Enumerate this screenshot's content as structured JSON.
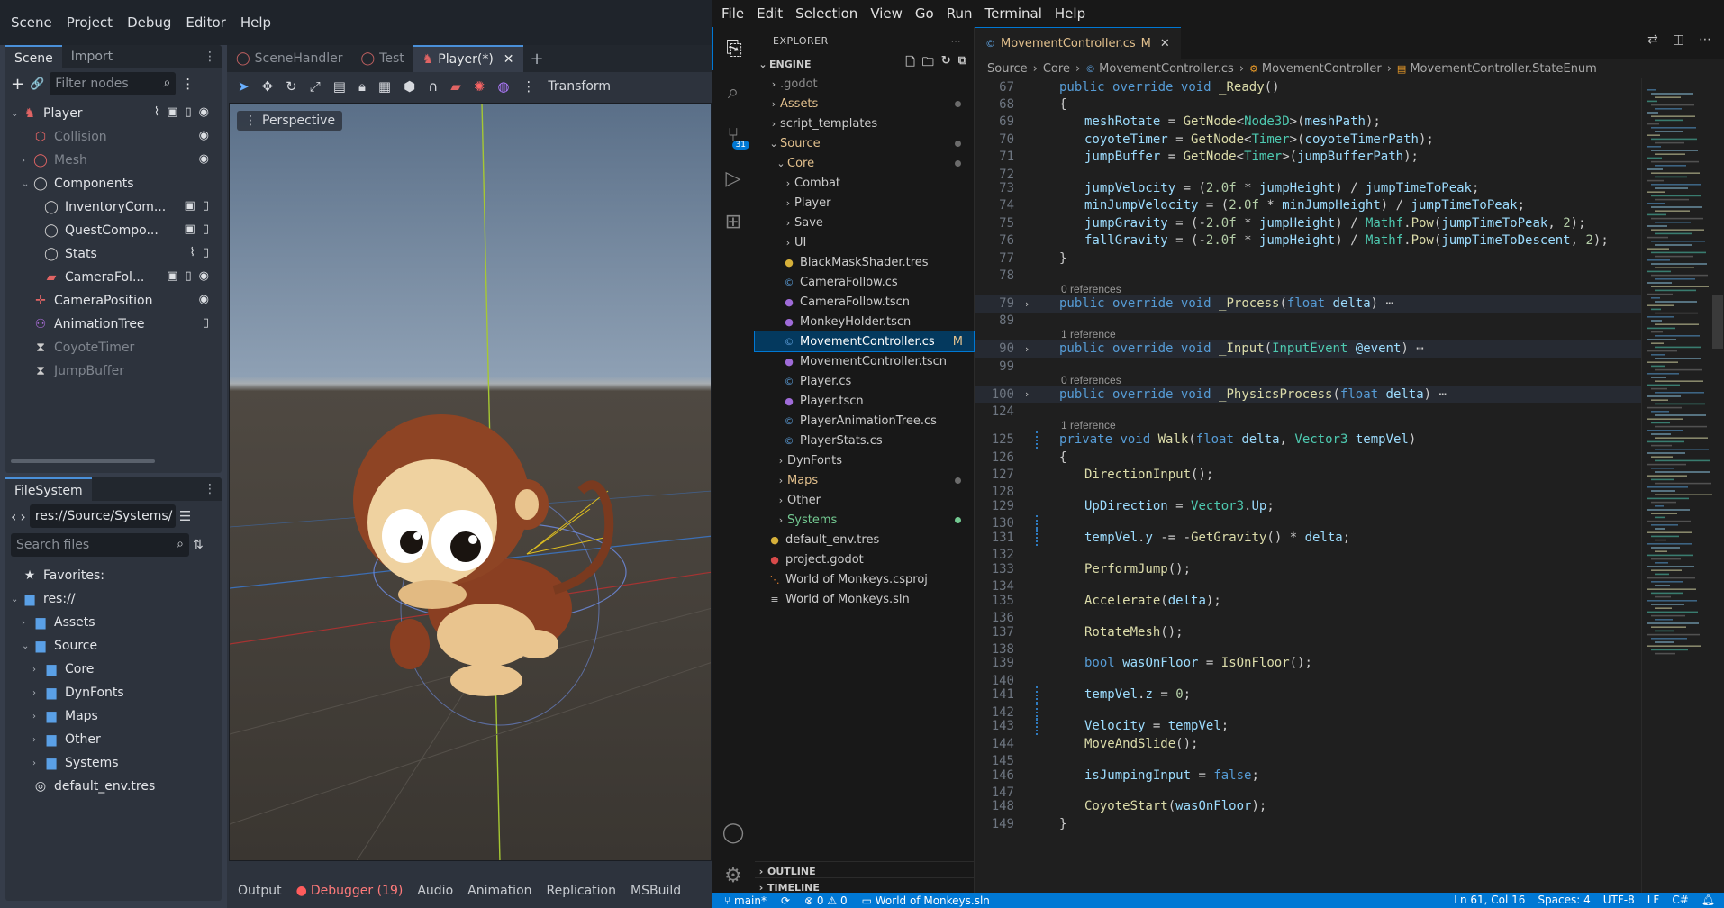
{
  "godot": {
    "menu": [
      "Scene",
      "Project",
      "Debug",
      "Editor",
      "Help"
    ],
    "scene_dock": {
      "tabs": [
        "Scene",
        "Import"
      ],
      "filter_placeholder": "Filter nodes",
      "nodes": [
        {
          "label": "Player",
          "depth": 0,
          "arrow": "v",
          "icon": "player-node-icon",
          "color": "#e06464"
        },
        {
          "label": "Collision",
          "depth": 1,
          "arrow": "",
          "icon": "collision-shape-icon",
          "color": "#e06464",
          "dim": true
        },
        {
          "label": "Mesh",
          "depth": 1,
          "arrow": ">",
          "icon": "mesh-node-icon",
          "color": "#e06464",
          "dim": true
        },
        {
          "label": "Components",
          "depth": 1,
          "arrow": "v",
          "icon": "node-icon",
          "color": "#cccccc"
        },
        {
          "label": "InventoryCom...",
          "depth": 2,
          "arrow": "",
          "icon": "node-icon",
          "color": "#cccccc"
        },
        {
          "label": "QuestCompo...",
          "depth": 2,
          "arrow": "",
          "icon": "node-icon",
          "color": "#cccccc"
        },
        {
          "label": "Stats",
          "depth": 2,
          "arrow": "",
          "icon": "node-icon",
          "color": "#cccccc"
        },
        {
          "label": "CameraFol...",
          "depth": 2,
          "arrow": "",
          "icon": "camera-node-icon",
          "color": "#e06464"
        },
        {
          "label": "CameraPosition",
          "depth": 1,
          "arrow": "",
          "icon": "marker-node-icon",
          "color": "#e06464"
        },
        {
          "label": "AnimationTree",
          "depth": 1,
          "arrow": "",
          "icon": "animation-tree-icon",
          "color": "#b070e0"
        },
        {
          "label": "CoyoteTimer",
          "depth": 1,
          "arrow": "",
          "icon": "timer-icon",
          "color": "#cccccc",
          "dim": true
        },
        {
          "label": "JumpBuffer",
          "depth": 1,
          "arrow": "",
          "icon": "timer-icon",
          "color": "#cccccc",
          "dim": true
        }
      ]
    },
    "filesystem": {
      "title": "FileSystem",
      "path": "res://Source/Systems/",
      "search_placeholder": "Search files",
      "items": [
        {
          "label": "Favorites:",
          "depth": 0,
          "arrow": "",
          "icon": "star-icon"
        },
        {
          "label": "res://",
          "depth": 0,
          "arrow": "v",
          "icon": "folder-icon"
        },
        {
          "label": "Assets",
          "depth": 1,
          "arrow": ">",
          "icon": "folder-icon"
        },
        {
          "label": "Source",
          "depth": 1,
          "arrow": "v",
          "icon": "folder-icon"
        },
        {
          "label": "Core",
          "depth": 2,
          "arrow": ">",
          "icon": "folder-icon"
        },
        {
          "label": "DynFonts",
          "depth": 2,
          "arrow": ">",
          "icon": "folder-icon"
        },
        {
          "label": "Maps",
          "depth": 2,
          "arrow": ">",
          "icon": "folder-icon"
        },
        {
          "label": "Other",
          "depth": 2,
          "arrow": ">",
          "icon": "folder-icon"
        },
        {
          "label": "Systems",
          "depth": 2,
          "arrow": ">",
          "icon": "folder-icon"
        },
        {
          "label": "default_env.tres",
          "depth": 1,
          "arrow": "",
          "icon": "globe-icon"
        }
      ]
    },
    "scene_tabs": [
      {
        "label": "SceneHandler",
        "active": false
      },
      {
        "label": "Test",
        "active": false
      },
      {
        "label": "Player(*)",
        "active": true
      }
    ],
    "toolbar_text": "Transform",
    "perspective_label": "Perspective",
    "bottom_tabs": [
      "Output",
      "Debugger (19)",
      "Audio",
      "Animation",
      "Replication",
      "MSBuild"
    ]
  },
  "vscode": {
    "menu": [
      "File",
      "Edit",
      "Selection",
      "View",
      "Go",
      "Run",
      "Terminal",
      "Help"
    ],
    "explorer": {
      "title": "EXPLORER",
      "section": "ENGINE",
      "items": [
        {
          "label": ".godot",
          "depth": 0,
          "chev": ">",
          "icon": "",
          "color": "#8b8b8b",
          "dot": ""
        },
        {
          "label": "Assets",
          "depth": 0,
          "chev": ">",
          "icon": "",
          "color": "#e2c08d",
          "dot": "#6b6b6b"
        },
        {
          "label": "script_templates",
          "depth": 0,
          "chev": ">",
          "icon": "",
          "color": "#cccccc",
          "dot": ""
        },
        {
          "label": "Source",
          "depth": 0,
          "chev": "v",
          "icon": "",
          "color": "#e2c08d",
          "dot": "#6b6b6b"
        },
        {
          "label": "Core",
          "depth": 1,
          "chev": "v",
          "icon": "",
          "color": "#e2c08d",
          "dot": "#6b6b6b"
        },
        {
          "label": "Combat",
          "depth": 2,
          "chev": ">",
          "icon": "",
          "color": "#cccccc",
          "dot": ""
        },
        {
          "label": "Player",
          "depth": 2,
          "chev": ">",
          "icon": "",
          "color": "#cccccc",
          "dot": ""
        },
        {
          "label": "Save",
          "depth": 2,
          "chev": ">",
          "icon": "",
          "color": "#cccccc",
          "dot": ""
        },
        {
          "label": "UI",
          "depth": 2,
          "chev": ">",
          "icon": "",
          "color": "#cccccc",
          "dot": ""
        },
        {
          "label": "BlackMaskShader.tres",
          "depth": 2,
          "chev": "",
          "icon": "tres-file-icon",
          "color": "#cccccc",
          "dot": ""
        },
        {
          "label": "CameraFollow.cs",
          "depth": 2,
          "chev": "",
          "icon": "csharp-file-icon",
          "color": "#cccccc",
          "dot": ""
        },
        {
          "label": "CameraFollow.tscn",
          "depth": 2,
          "chev": "",
          "icon": "tscn-file-icon",
          "color": "#cccccc",
          "dot": ""
        },
        {
          "label": "MonkeyHolder.tscn",
          "depth": 2,
          "chev": "",
          "icon": "tscn-file-icon",
          "color": "#cccccc",
          "dot": ""
        },
        {
          "label": "MovementController.cs",
          "depth": 2,
          "chev": "",
          "icon": "csharp-file-icon",
          "color": "#ffffff",
          "dot": "",
          "selected": true,
          "badge": "M"
        },
        {
          "label": "MovementController.tscn",
          "depth": 2,
          "chev": "",
          "icon": "tscn-file-icon",
          "color": "#cccccc",
          "dot": ""
        },
        {
          "label": "Player.cs",
          "depth": 2,
          "chev": "",
          "icon": "csharp-file-icon",
          "color": "#cccccc",
          "dot": ""
        },
        {
          "label": "Player.tscn",
          "depth": 2,
          "chev": "",
          "icon": "tscn-file-icon",
          "color": "#cccccc",
          "dot": ""
        },
        {
          "label": "PlayerAnimationTree.cs",
          "depth": 2,
          "chev": "",
          "icon": "csharp-file-icon",
          "color": "#cccccc",
          "dot": ""
        },
        {
          "label": "PlayerStats.cs",
          "depth": 2,
          "chev": "",
          "icon": "csharp-file-icon",
          "color": "#cccccc",
          "dot": ""
        },
        {
          "label": "DynFonts",
          "depth": 1,
          "chev": ">",
          "icon": "",
          "color": "#cccccc",
          "dot": ""
        },
        {
          "label": "Maps",
          "depth": 1,
          "chev": ">",
          "icon": "",
          "color": "#e2c08d",
          "dot": "#6b6b6b"
        },
        {
          "label": "Other",
          "depth": 1,
          "chev": ">",
          "icon": "",
          "color": "#cccccc",
          "dot": ""
        },
        {
          "label": "Systems",
          "depth": 1,
          "chev": ">",
          "icon": "",
          "color": "#73c991",
          "dot": "#73c991"
        },
        {
          "label": "default_env.tres",
          "depth": 0,
          "chev": "",
          "icon": "tres-file-icon",
          "color": "#cccccc",
          "dot": ""
        },
        {
          "label": "project.godot",
          "depth": 0,
          "chev": "",
          "icon": "godot-file-icon",
          "color": "#cccccc",
          "dot": ""
        },
        {
          "label": "World of Monkeys.csproj",
          "depth": 0,
          "chev": "",
          "icon": "rss-icon",
          "color": "#cccccc",
          "dot": ""
        },
        {
          "label": "World of Monkeys.sln",
          "depth": 0,
          "chev": "",
          "icon": "sln-file-icon",
          "color": "#cccccc",
          "dot": ""
        }
      ],
      "outline_label": "OUTLINE",
      "timeline_label": "TIMELINE"
    },
    "editor_tab": {
      "label": "MovementController.cs",
      "badge": "M"
    },
    "breadcrumb": [
      "Source",
      "Core",
      "MovementController.cs",
      "MovementController",
      "MovementController.StateEnum"
    ],
    "code_lines": [
      {
        "n": "67",
        "text": "public override void _Ready()",
        "indent": 0
      },
      {
        "n": "68",
        "text": "{",
        "indent": 0
      },
      {
        "n": "69",
        "text": "meshRotate = GetNode<Node3D>(meshPath);",
        "indent": 1
      },
      {
        "n": "70",
        "text": "coyoteTimer = GetNode<Timer>(coyoteTimerPath);",
        "indent": 1
      },
      {
        "n": "71",
        "text": "jumpBuffer = GetNode<Timer>(jumpBufferPath);",
        "indent": 1
      },
      {
        "n": "72",
        "text": "",
        "indent": 0
      },
      {
        "n": "73",
        "text": "jumpVelocity = (2.0f * jumpHeight) / jumpTimeToPeak;",
        "indent": 1
      },
      {
        "n": "74",
        "text": "minJumpVelocity = (2.0f * minJumpHeight) / jumpTimeToPeak;",
        "indent": 1
      },
      {
        "n": "75",
        "text": "jumpGravity = (-2.0f * jumpHeight) / Mathf.Pow(jumpTimeToPeak, 2);",
        "indent": 1
      },
      {
        "n": "76",
        "text": "fallGravity = (-2.0f * jumpHeight) / Mathf.Pow(jumpTimeToDescent, 2);",
        "indent": 1
      },
      {
        "n": "77",
        "text": "}",
        "indent": 0
      },
      {
        "n": "78",
        "text": "",
        "indent": 0
      },
      {
        "refs": "0 references"
      },
      {
        "n": "79",
        "text": "public override void _Process(float delta) ⋯",
        "indent": 0,
        "fold": true,
        "hl": true
      },
      {
        "n": "89",
        "text": "",
        "indent": 0
      },
      {
        "refs": "1 reference"
      },
      {
        "n": "90",
        "text": "public override void _Input(InputEvent @event) ⋯",
        "indent": 0,
        "fold": true,
        "hl": true
      },
      {
        "n": "99",
        "text": "",
        "indent": 0
      },
      {
        "refs": "0 references"
      },
      {
        "n": "100",
        "text": "public override void _PhysicsProcess(float delta) ⋯",
        "indent": 0,
        "fold": true,
        "hl": true
      },
      {
        "n": "124",
        "text": "",
        "indent": 0
      },
      {
        "refs": "1 reference"
      },
      {
        "n": "125",
        "text": "private void Walk(float delta, Vector3 tempVel)",
        "indent": 0,
        "gm": true
      },
      {
        "n": "126",
        "text": "{",
        "indent": 0
      },
      {
        "n": "127",
        "text": "DirectionInput();",
        "indent": 1
      },
      {
        "n": "128",
        "text": "",
        "indent": 0
      },
      {
        "n": "129",
        "text": "UpDirection = Vector3.Up;",
        "indent": 1
      },
      {
        "n": "130",
        "text": "",
        "indent": 0,
        "gm": true
      },
      {
        "n": "131",
        "text": "tempVel.y -= -GetGravity() * delta;",
        "indent": 1,
        "gm": true
      },
      {
        "n": "132",
        "text": "",
        "indent": 0
      },
      {
        "n": "133",
        "text": "PerformJump();",
        "indent": 1
      },
      {
        "n": "134",
        "text": "",
        "indent": 0
      },
      {
        "n": "135",
        "text": "Accelerate(delta);",
        "indent": 1
      },
      {
        "n": "136",
        "text": "",
        "indent": 0
      },
      {
        "n": "137",
        "text": "RotateMesh();",
        "indent": 1
      },
      {
        "n": "138",
        "text": "",
        "indent": 0
      },
      {
        "n": "139",
        "text": "bool wasOnFloor = IsOnFloor();",
        "indent": 1
      },
      {
        "n": "140",
        "text": "",
        "indent": 0
      },
      {
        "n": "141",
        "text": "tempVel.z = 0;",
        "indent": 1,
        "gm": true
      },
      {
        "n": "142",
        "text": "",
        "indent": 0,
        "gm": true
      },
      {
        "n": "143",
        "text": "Velocity = tempVel;",
        "indent": 1,
        "gm": true
      },
      {
        "n": "144",
        "text": "MoveAndSlide();",
        "indent": 1
      },
      {
        "n": "145",
        "text": "",
        "indent": 0
      },
      {
        "n": "146",
        "text": "isJumpingInput = false;",
        "indent": 1
      },
      {
        "n": "147",
        "text": "",
        "indent": 0
      },
      {
        "n": "148",
        "text": "CoyoteStart(wasOnFloor);",
        "indent": 1
      },
      {
        "n": "149",
        "text": "}",
        "indent": 0
      }
    ],
    "status": {
      "branch": "main*",
      "errors": "⊗ 0 ⚠ 0",
      "project": "World of Monkeys.sln",
      "position": "Ln 61, Col 16",
      "spaces": "Spaces: 4",
      "encoding": "UTF-8",
      "eol": "LF",
      "language": "C#"
    },
    "badge_count": "31"
  },
  "colors": {
    "vscode_accent": "#0078d4",
    "godot_accent": "#4a90d9",
    "modified": "#e2c08d"
  }
}
